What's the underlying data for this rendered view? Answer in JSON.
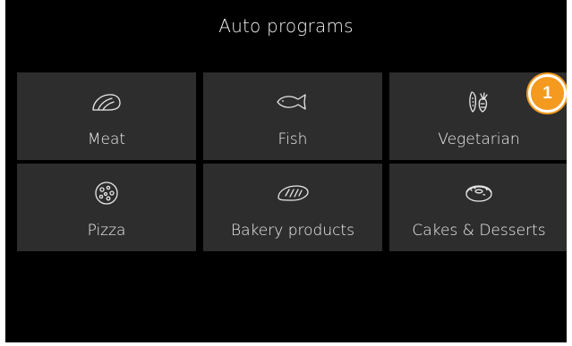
{
  "title": "Auto programs",
  "badge": "1",
  "accent_color": "#f39a1f",
  "tiles": [
    {
      "label": "Meat",
      "icon": "meat-icon"
    },
    {
      "label": "Fish",
      "icon": "fish-icon"
    },
    {
      "label": "Vegetarian",
      "icon": "vegetarian-icon"
    },
    {
      "label": "Pizza",
      "icon": "pizza-icon"
    },
    {
      "label": "Bakery products",
      "icon": "bread-icon"
    },
    {
      "label": "Cakes & Desserts",
      "icon": "donut-icon"
    }
  ]
}
